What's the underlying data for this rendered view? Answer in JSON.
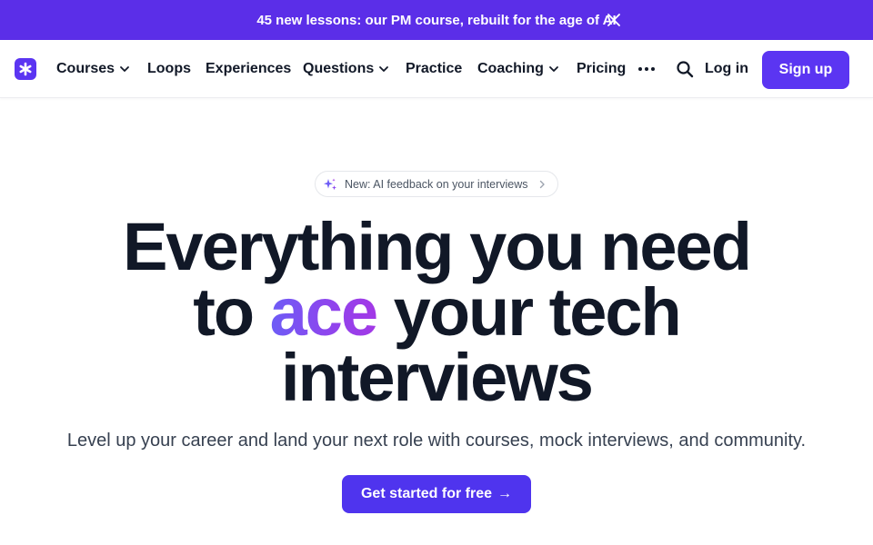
{
  "banner": {
    "text": "45 new lessons: our PM course, rebuilt for the age of AI",
    "close_icon": "close-icon",
    "background": "#5b2ee8"
  },
  "nav": {
    "logo_icon": "asterisk-logo-icon",
    "items": [
      {
        "label": "Courses",
        "has_dropdown": true
      },
      {
        "label": "Loops",
        "has_dropdown": false
      },
      {
        "label": "Experiences",
        "has_dropdown": false
      },
      {
        "label": "Questions",
        "has_dropdown": true
      },
      {
        "label": "Practice",
        "has_dropdown": false
      },
      {
        "label": "Coaching",
        "has_dropdown": true
      },
      {
        "label": "Pricing",
        "has_dropdown": false
      }
    ],
    "more_icon": "more-horizontal-icon",
    "search_icon": "search-icon",
    "login_label": "Log in",
    "signup_label": "Sign up",
    "accent": "#5b35f2"
  },
  "hero": {
    "pill_text": "New: AI feedback on your interviews",
    "pill_icon": "sparkle-icon",
    "headline_line1": "Everything you need",
    "headline_line2_pre": "to ",
    "headline_line2_accent": "ace",
    "headline_line2_post": " your tech",
    "headline_line3": "interviews",
    "subtitle": "Level up your career and land your next role with courses, mock interviews, and community.",
    "cta_label": "Get started for free",
    "cta_arrow": "→"
  }
}
